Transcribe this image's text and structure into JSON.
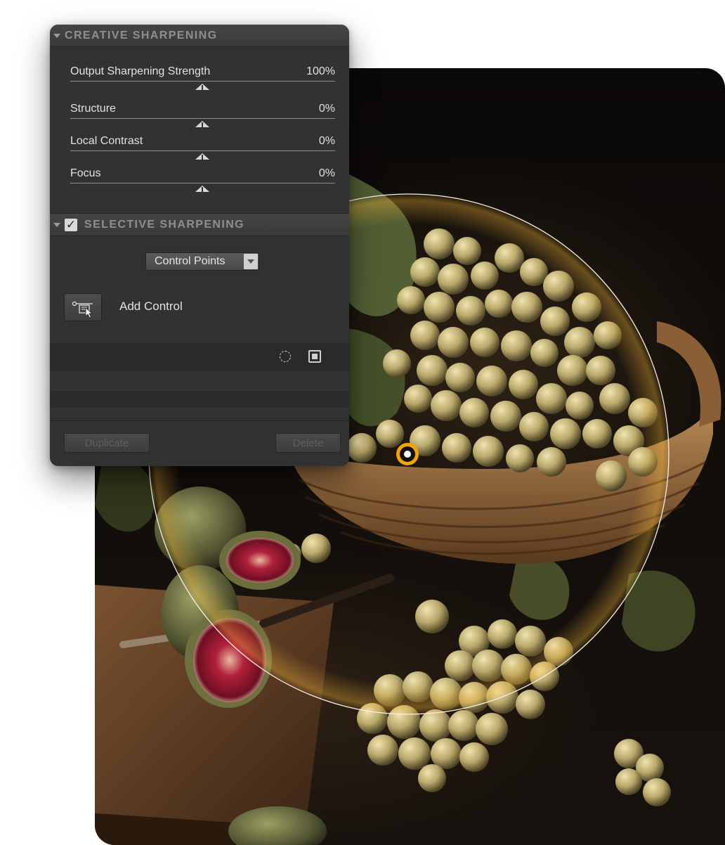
{
  "creative_sharpening": {
    "title": "CREATIVE SHARPENING",
    "sliders": [
      {
        "label": "Output Sharpening Strength",
        "value": "100%"
      },
      {
        "label": "Structure",
        "value": "0%"
      },
      {
        "label": "Local Contrast",
        "value": "0%"
      },
      {
        "label": "Focus",
        "value": "0%"
      }
    ]
  },
  "selective_sharpening": {
    "title": "SELECTIVE SHARPENING",
    "enabled_mark": "✓",
    "mode": "Control Points",
    "add_label": "Add Control"
  },
  "footer": {
    "duplicate_label": "Duplicate",
    "delete_label": "Delete"
  },
  "icons": {
    "section_collapse": "triangle-down-icon",
    "add_control": "control-point-cursor-icon",
    "show_selection": "dashed-circle-icon",
    "show_mask": "mask-square-icon"
  },
  "colors": {
    "panel_bg": "#323232",
    "control_point_ring": "#f2a500"
  }
}
